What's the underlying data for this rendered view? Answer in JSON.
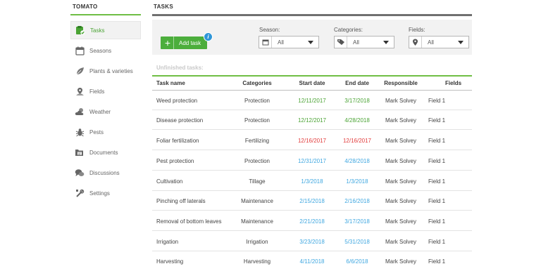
{
  "sidebar": {
    "title": "TOMATO",
    "items": [
      {
        "label": "Tasks",
        "icon": "tasks-icon",
        "active": true
      },
      {
        "label": "Seasons",
        "icon": "calendar-icon",
        "active": false
      },
      {
        "label": "Plants & varieties",
        "icon": "leaf-icon",
        "active": false
      },
      {
        "label": "Fields",
        "icon": "map-pin-icon",
        "active": false
      },
      {
        "label": "Weather",
        "icon": "cloud-icon",
        "active": false
      },
      {
        "label": "Pests",
        "icon": "bug-icon",
        "active": false
      },
      {
        "label": "Documents",
        "icon": "folder-icon",
        "active": false
      },
      {
        "label": "Discussions",
        "icon": "chat-icon",
        "active": false
      },
      {
        "label": "Settings",
        "icon": "tools-icon",
        "active": false
      }
    ]
  },
  "main": {
    "title": "TASKS",
    "add_task_label": "Add task",
    "info_glyph": "i",
    "filters": {
      "season": {
        "label": "Season:",
        "value": "All"
      },
      "categories": {
        "label": "Categories:",
        "value": "All"
      },
      "fields": {
        "label": "Fields:",
        "value": "All"
      }
    },
    "section_title": "Unfinished tasks:",
    "columns": [
      "Task name",
      "Categories",
      "Start date",
      "End date",
      "Responsible",
      "Fields"
    ],
    "rows": [
      {
        "name": "Weed protection",
        "category": "Protection",
        "start": "12/11/2017",
        "start_status": "green",
        "end": "3/17/2018",
        "end_status": "green",
        "responsible": "Mark Solvey",
        "field": "Field 1"
      },
      {
        "name": "Disease protection",
        "category": "Protection",
        "start": "12/12/2017",
        "start_status": "green",
        "end": "4/28/2018",
        "end_status": "green",
        "responsible": "Mark Solvey",
        "field": "Field 1"
      },
      {
        "name": "Foliar fertilization",
        "category": "Fertilizing",
        "start": "12/16/2017",
        "start_status": "red",
        "end": "12/16/2017",
        "end_status": "red",
        "responsible": "Mark Solvey",
        "field": "Field 1"
      },
      {
        "name": "Pest protection",
        "category": "Protection",
        "start": "12/31/2017",
        "start_status": "blue",
        "end": "4/28/2018",
        "end_status": "blue",
        "responsible": "Mark Solvey",
        "field": "Field 1"
      },
      {
        "name": "Cultivation",
        "category": "Tillage",
        "start": "1/3/2018",
        "start_status": "blue",
        "end": "1/3/2018",
        "end_status": "blue",
        "responsible": "Mark Solvey",
        "field": "Field 1"
      },
      {
        "name": "Pinching off laterals",
        "category": "Maintenance",
        "start": "2/15/2018",
        "start_status": "blue",
        "end": "2/16/2018",
        "end_status": "blue",
        "responsible": "Mark Solvey",
        "field": "Field 1"
      },
      {
        "name": "Removal of bottom leaves",
        "category": "Maintenance",
        "start": "2/21/2018",
        "start_status": "blue",
        "end": "3/17/2018",
        "end_status": "blue",
        "responsible": "Mark Solvey",
        "field": "Field 1"
      },
      {
        "name": "Irrigation",
        "category": "Irrigation",
        "start": "3/23/2018",
        "start_status": "blue",
        "end": "5/31/2018",
        "end_status": "blue",
        "responsible": "Mark Solvey",
        "field": "Field 1"
      },
      {
        "name": "Harvesting",
        "category": "Harvesting",
        "start": "4/11/2018",
        "start_status": "blue",
        "end": "6/6/2018",
        "end_status": "blue",
        "responsible": "Mark Solvey",
        "field": "Field 1"
      }
    ]
  },
  "colors": {
    "accent_green": "#4cae3c",
    "status_green": "#4aa334",
    "status_red": "#e23b3b",
    "status_blue": "#3fa7e0",
    "info_blue": "#2f96d8"
  }
}
